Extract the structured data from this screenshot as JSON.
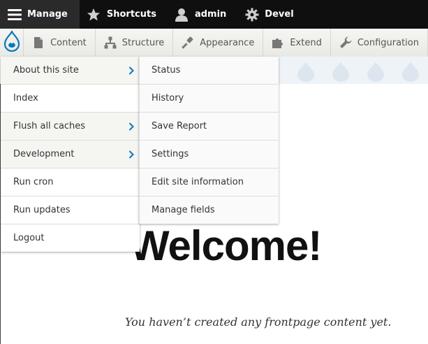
{
  "toolbar": {
    "manage": "Manage",
    "shortcuts": "Shortcuts",
    "user": "admin",
    "devel": "Devel"
  },
  "tray": {
    "content": "Content",
    "structure": "Structure",
    "appearance": "Appearance",
    "extend": "Extend",
    "configuration": "Configuration"
  },
  "menu": {
    "items": [
      {
        "label": "About this site",
        "has_submenu": true
      },
      {
        "label": "Index",
        "has_submenu": false
      },
      {
        "label": "Flush all caches",
        "has_submenu": true
      },
      {
        "label": "Development",
        "has_submenu": true
      },
      {
        "label": "Run cron",
        "has_submenu": false
      },
      {
        "label": "Run updates",
        "has_submenu": false
      },
      {
        "label": "Logout",
        "has_submenu": false
      }
    ]
  },
  "submenu": {
    "items": [
      {
        "label": "Status"
      },
      {
        "label": "History"
      },
      {
        "label": "Save Report"
      },
      {
        "label": "Settings"
      },
      {
        "label": "Edit site information"
      },
      {
        "label": "Manage fields"
      }
    ]
  },
  "page": {
    "heading": "Welcome!",
    "subtext": "You haven’t created any frontpage content yet."
  },
  "colors": {
    "toolbar_bg": "#0f0f0f",
    "accent_blue": "#0678be",
    "hero_bg": "#eef3f8"
  }
}
